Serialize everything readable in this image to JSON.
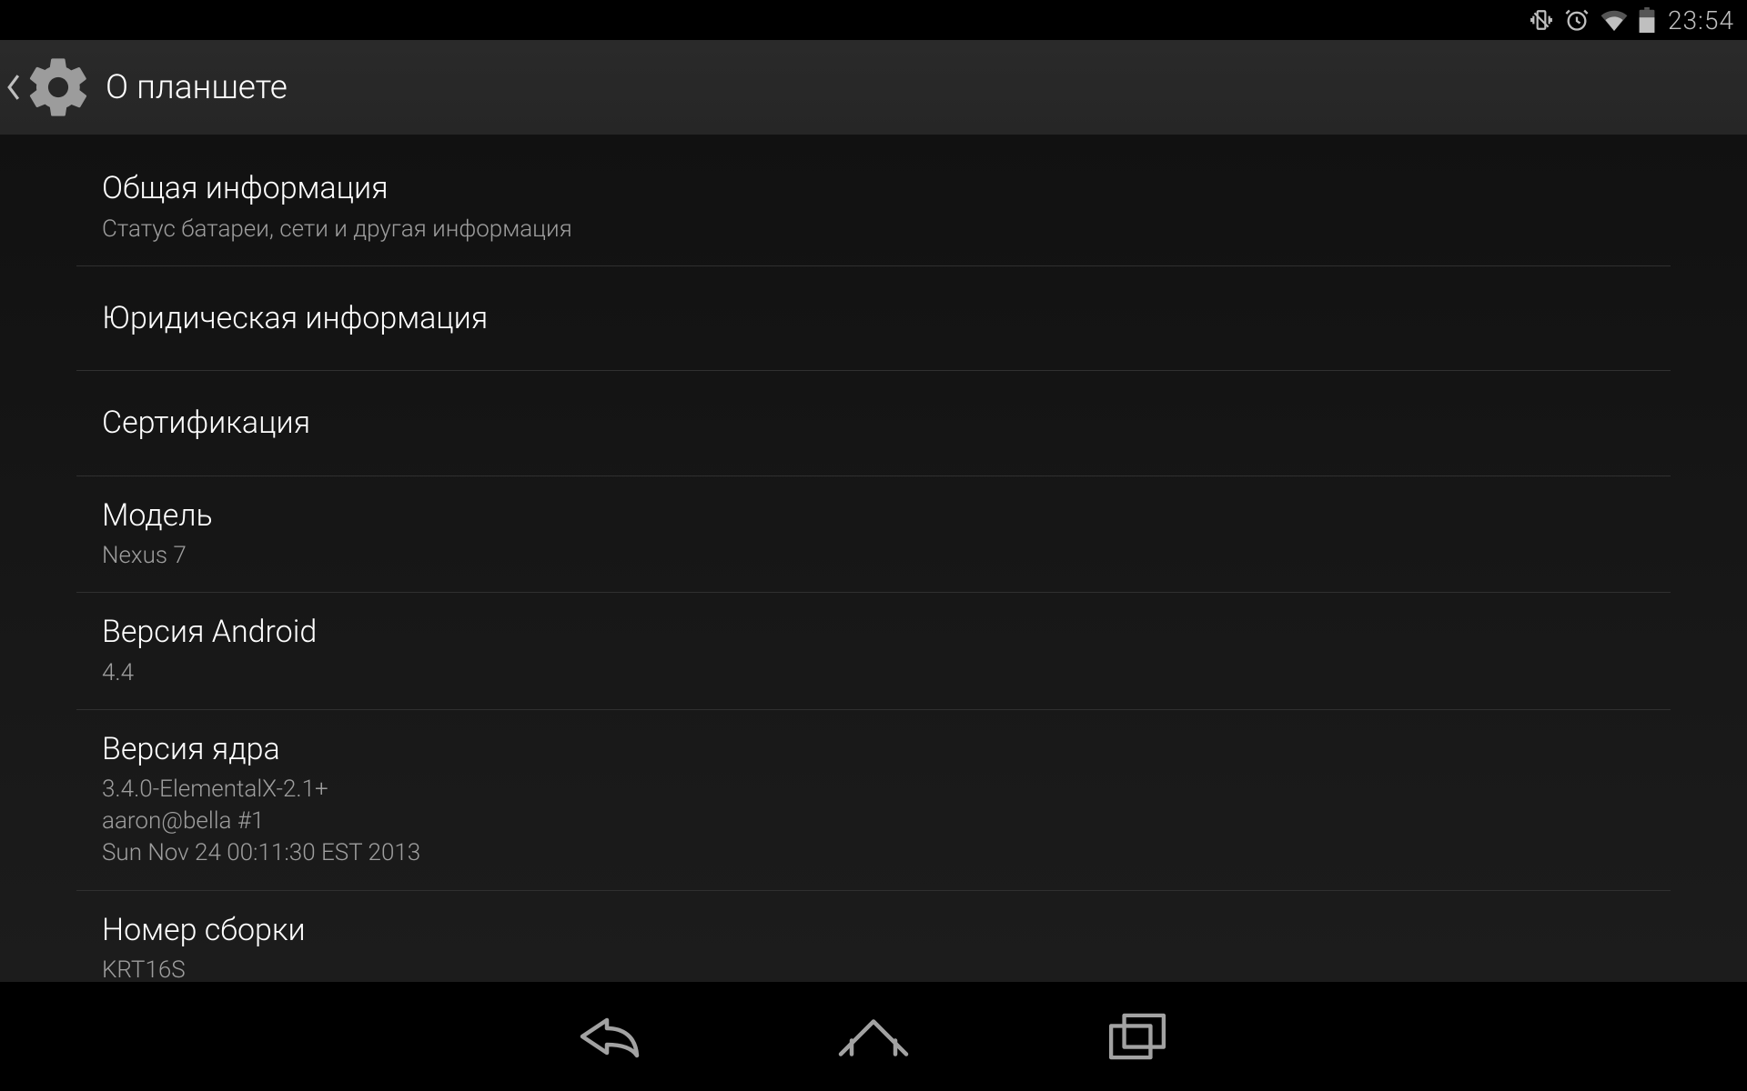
{
  "status_bar": {
    "time": "23:54",
    "icons": [
      "vibrate-icon",
      "alarm-icon",
      "wifi-icon",
      "battery-icon"
    ]
  },
  "action_bar": {
    "title": "О планшете",
    "icon": "gear-icon",
    "back": "back-icon"
  },
  "list": [
    {
      "id": "general-info",
      "title": "Общая информация",
      "sub": "Статус батареи, сети и другая информация"
    },
    {
      "id": "legal-info",
      "title": "Юридическая информация"
    },
    {
      "id": "certification",
      "title": "Сертификация"
    },
    {
      "id": "model",
      "title": "Модель",
      "sub": "Nexus 7"
    },
    {
      "id": "android-version",
      "title": "Версия Android",
      "sub": "4.4"
    },
    {
      "id": "kernel-version",
      "title": "Версия ядра",
      "sub": "3.4.0-ElementalX-2.1+\naaron@bella #1\nSun Nov 24 00:11:30 EST 2013"
    },
    {
      "id": "build-number",
      "title": "Номер сборки",
      "sub": "KRT16S"
    }
  ],
  "nav_bar": {
    "back": "nav-back-icon",
    "home": "nav-home-icon",
    "recent": "nav-recent-icon"
  }
}
